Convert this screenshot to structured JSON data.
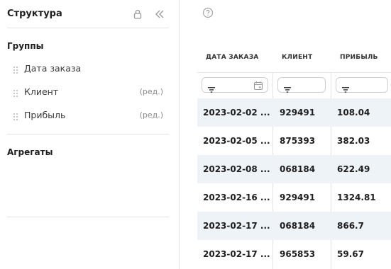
{
  "structure_panel": {
    "title": "Структура",
    "groups_title": "Группы",
    "groups": [
      {
        "label": "Дата заказа",
        "edit": ""
      },
      {
        "label": "Клиент",
        "edit": "(ред.)"
      },
      {
        "label": "Прибыль",
        "edit": "(ред.)"
      }
    ],
    "aggregates_title": "Агрегаты"
  },
  "table": {
    "columns": [
      "ДАТА ЗАКАЗА",
      "КЛИЕНТ",
      "ПРИБЫЛЬ"
    ],
    "rows": [
      [
        "2023-02-02 ...",
        "929491",
        "108.04"
      ],
      [
        "2023-02-05 ...",
        "875393",
        "382.03"
      ],
      [
        "2023-02-08 ...",
        "068184",
        "622.49"
      ],
      [
        "2023-02-16 ...",
        "929491",
        "1324.81"
      ],
      [
        "2023-02-17 ...",
        "068184",
        "866.7"
      ],
      [
        "2023-02-17 ...",
        "965853",
        "59.67"
      ]
    ]
  },
  "colors": {
    "row_alt": "#eef3f7",
    "border": "#e3e3e3"
  },
  "icons": [
    "lock-icon",
    "collapse-left-icon",
    "drag-handle-icon",
    "help-icon",
    "filter-icon",
    "calendar-icon"
  ]
}
